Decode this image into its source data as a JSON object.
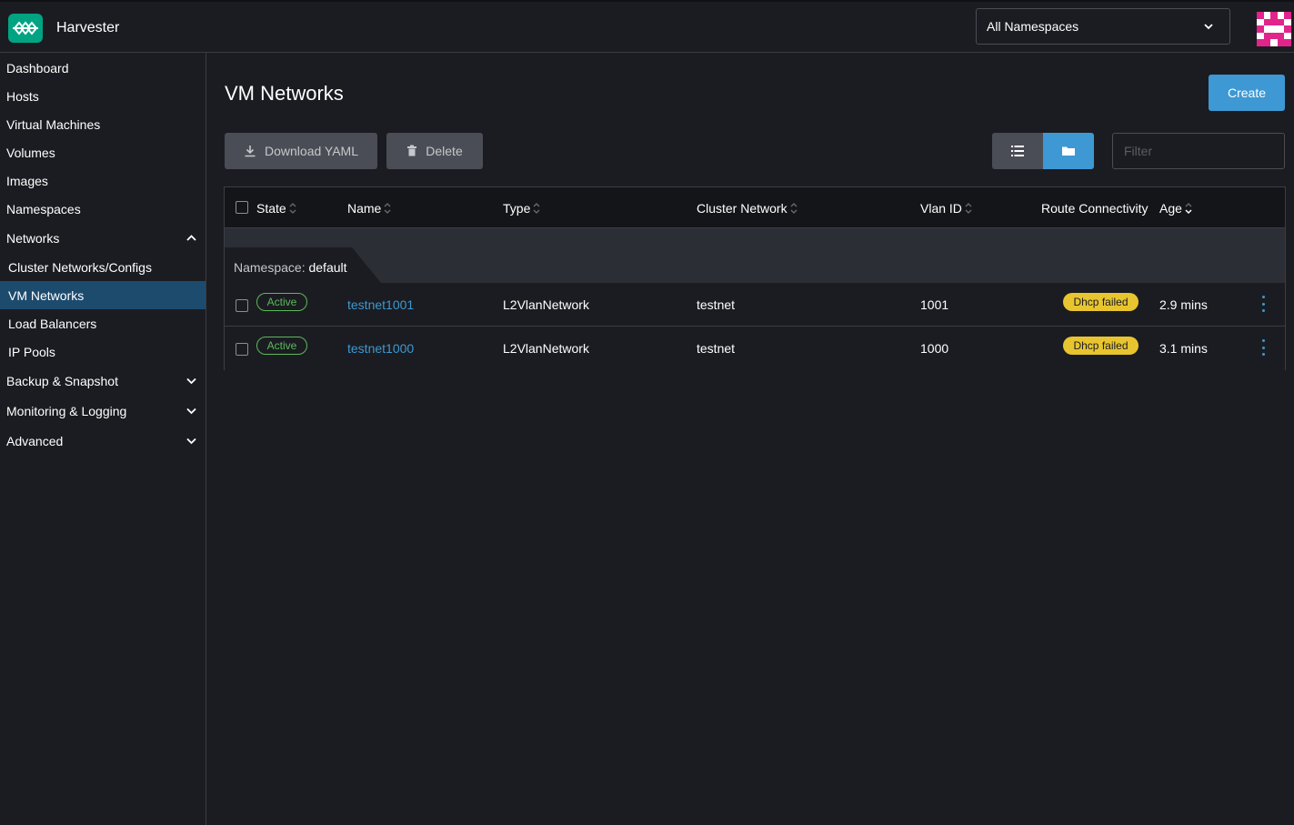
{
  "header": {
    "app_title": "Harvester",
    "namespace_select": {
      "value": "All Namespaces"
    }
  },
  "sidebar": {
    "items": [
      {
        "label": "Dashboard"
      },
      {
        "label": "Hosts"
      },
      {
        "label": "Virtual Machines"
      },
      {
        "label": "Volumes"
      },
      {
        "label": "Images"
      },
      {
        "label": "Namespaces"
      },
      {
        "label": "Networks",
        "expanded": true
      },
      {
        "label": "Cluster Networks/Configs"
      },
      {
        "label": "VM Networks",
        "active": true
      },
      {
        "label": "Load Balancers"
      },
      {
        "label": "IP Pools"
      },
      {
        "label": "Backup & Snapshot",
        "expanded": false
      },
      {
        "label": "Monitoring & Logging",
        "expanded": false
      },
      {
        "label": "Advanced",
        "expanded": false
      }
    ]
  },
  "main": {
    "title": "VM Networks",
    "create_label": "Create",
    "download_label": "Download YAML",
    "delete_label": "Delete",
    "filter_placeholder": "Filter",
    "view_mode": "group-by-namespace"
  },
  "table": {
    "columns": [
      "State",
      "Name",
      "Type",
      "Cluster Network",
      "Vlan ID",
      "Route Connectivity",
      "Age"
    ],
    "group": {
      "prefix": "Namespace:",
      "value": "default"
    },
    "rows": [
      {
        "state": "Active",
        "name": "testnet1001",
        "type": "L2VlanNetwork",
        "cluster_network": "testnet",
        "vlan_id": "1001",
        "route": "Dhcp failed",
        "age": "2.9 mins"
      },
      {
        "state": "Active",
        "name": "testnet1000",
        "type": "L2VlanNetwork",
        "cluster_network": "testnet",
        "vlan_id": "1000",
        "route": "Dhcp failed",
        "age": "3.1 mins"
      }
    ]
  },
  "colors": {
    "accent": "#3d98d3",
    "brand": "#00a483",
    "active": "#5bb95b",
    "warning": "#e8c530",
    "sidebar_active": "#1d4b6e"
  }
}
